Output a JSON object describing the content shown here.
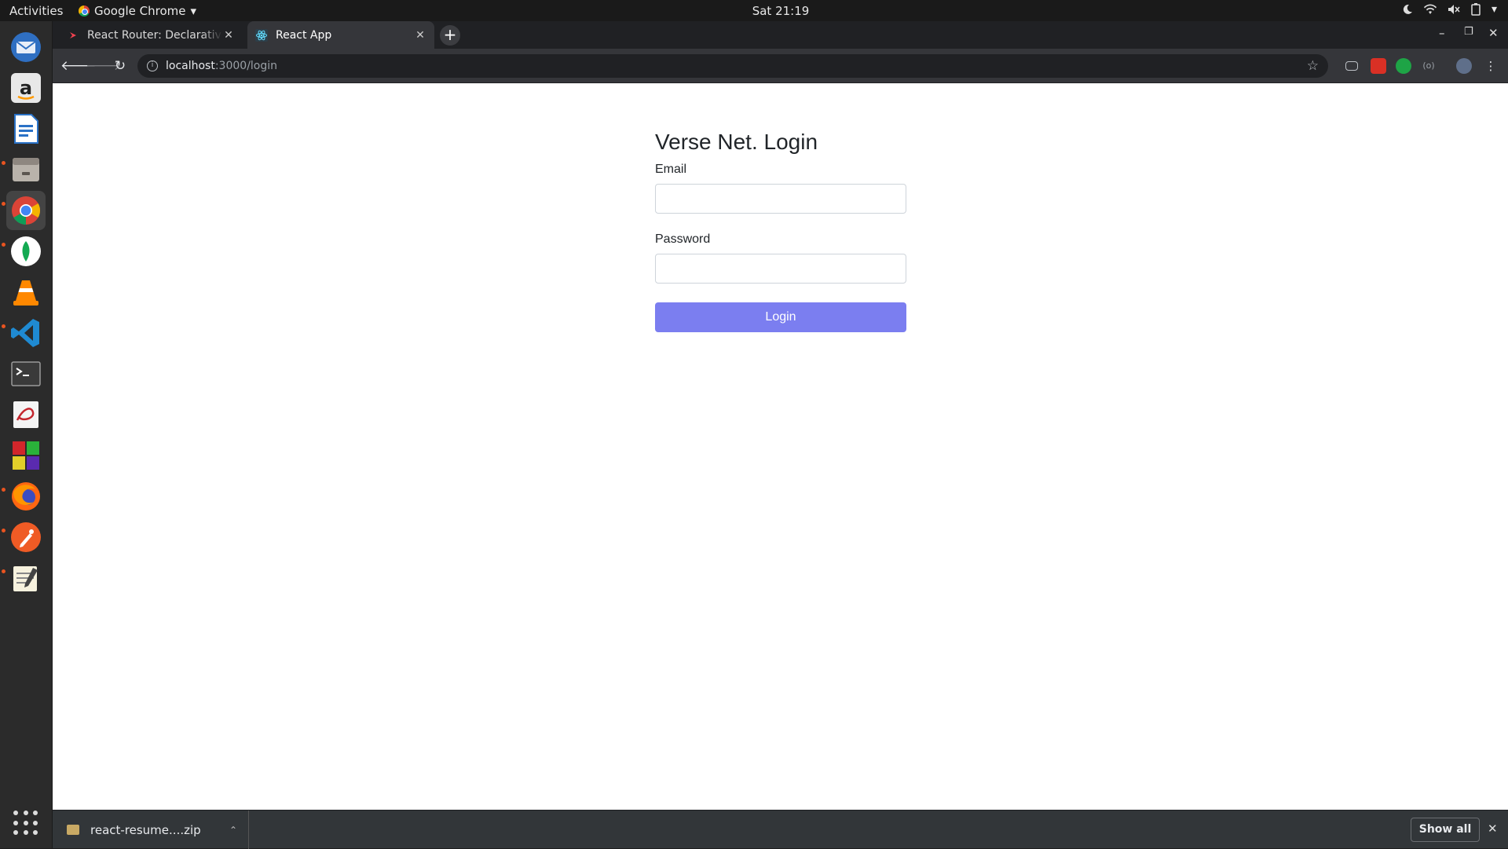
{
  "topbar": {
    "activities": "Activities",
    "app_name": "Google Chrome",
    "app_caret": "▾",
    "clock": "Sat 21:19"
  },
  "dock": {
    "items": [
      "thunderbird-icon",
      "amazon-icon",
      "libreoffice-writer-icon",
      "files-icon",
      "chrome-icon",
      "mongodb-compass-icon",
      "vlc-icon",
      "vscode-icon",
      "terminal-icon",
      "evince-icon",
      "rubik-icon",
      "firefox-icon",
      "postman-icon",
      "text-editor-icon"
    ]
  },
  "browser": {
    "tabs": [
      {
        "title": "React Router: Declarative",
        "active": false
      },
      {
        "title": "React App",
        "active": true
      }
    ],
    "new_tab": "+",
    "url_host": "localhost",
    "url_path": ":3000/login",
    "window_controls": {
      "minimize": "–",
      "maximize": "❐",
      "close": "✕"
    }
  },
  "page": {
    "heading": "Verse Net. Login",
    "email_label": "Email",
    "email_value": "",
    "password_label": "Password",
    "password_value": "",
    "login_button": "Login"
  },
  "downloads": {
    "filename": "react-resume....zip",
    "show_all": "Show all",
    "close": "✕"
  },
  "colors": {
    "login_button": "#7b7ef0",
    "tab_bar": "#202124",
    "toolbar": "#35363a"
  }
}
